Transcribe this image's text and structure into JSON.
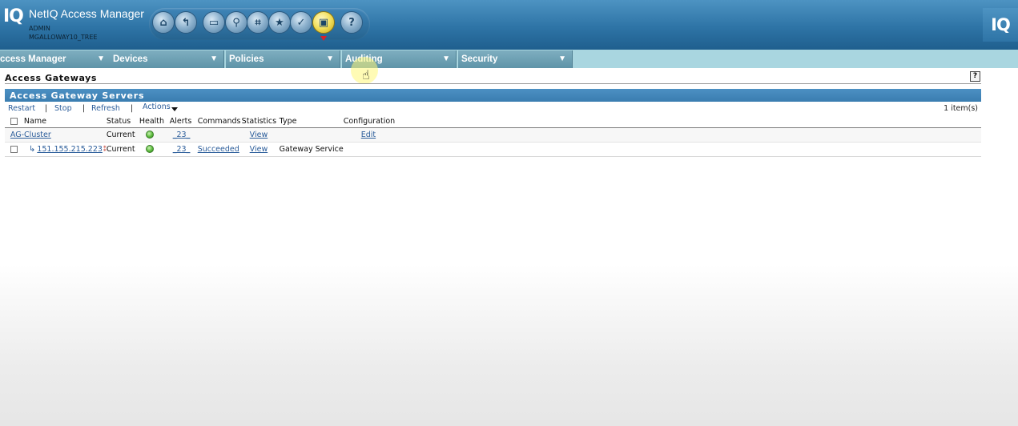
{
  "header": {
    "logo_text": "IQ",
    "app_title": "NetIQ Access Manager",
    "user": "ADMIN",
    "tree": "MGALLOWAY10_TREE",
    "right_logo_text": "IQ",
    "toolbar": {
      "buttons": [
        {
          "icon": "folder-home-icon",
          "glyph": "⌂"
        },
        {
          "icon": "back-arrow-icon",
          "glyph": "↰"
        },
        {
          "icon": "id-card-icon",
          "glyph": "▭"
        },
        {
          "icon": "search-icon",
          "glyph": "⚲"
        },
        {
          "icon": "hierarchy-icon",
          "glyph": "⌗"
        },
        {
          "icon": "star-icon",
          "glyph": "★"
        },
        {
          "icon": "check-icon",
          "glyph": "✓"
        },
        {
          "icon": "monitor-icon",
          "glyph": "▣"
        },
        {
          "icon": "help-icon",
          "glyph": "?"
        }
      ]
    }
  },
  "nav": {
    "tabs": [
      {
        "label": "ccess Manager"
      },
      {
        "label": "Devices"
      },
      {
        "label": "Policies"
      },
      {
        "label": "Auditing"
      },
      {
        "label": "Security"
      }
    ],
    "arrow": "▼"
  },
  "page": {
    "title": "Access Gateways",
    "help": "?",
    "section_title": "Access Gateway Servers",
    "actions": {
      "restart": "Restart",
      "stop": "Stop",
      "refresh": "Refresh",
      "actions": "Actions",
      "separator": "|"
    },
    "count": "1 item(s)"
  },
  "table": {
    "columns": [
      "Name",
      "Status",
      "Health",
      "Alerts",
      "Commands",
      "Statistics",
      "Type",
      "Configuration"
    ],
    "rows": [
      {
        "name": "AG-Cluster",
        "status": "Current",
        "alerts": "_23_",
        "commands": "",
        "statistics": "View",
        "type": "",
        "configuration": "Edit"
      },
      {
        "name": "151.155.215.223",
        "status": "Current",
        "alerts": "_23_",
        "commands": "Succeeded",
        "statistics": "View",
        "type": "Gateway Service",
        "configuration": ""
      }
    ]
  },
  "colors": {
    "header_blue": "#2e74a6",
    "nav_tab": "#6ea2b5",
    "section_bar": "#4186b9",
    "link": "#2a5c9a",
    "health_ok": "#5dbb3d"
  }
}
